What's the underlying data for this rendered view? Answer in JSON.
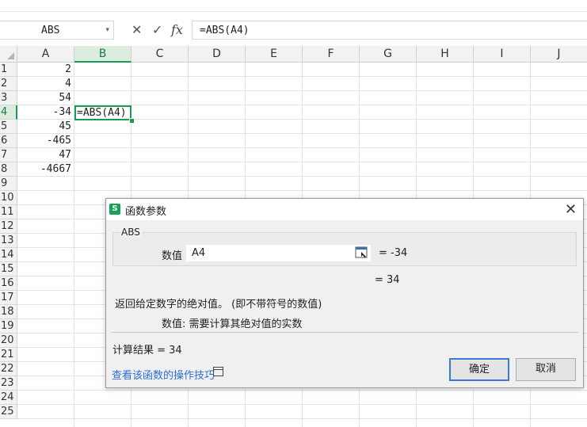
{
  "formula_bar": {
    "name_box": "ABS",
    "cancel_icon": "✕",
    "confirm_icon": "✓",
    "fx_label": "fx",
    "formula": "=ABS(A4)"
  },
  "grid": {
    "columns": [
      "A",
      "B",
      "C",
      "D",
      "E",
      "F",
      "G",
      "H",
      "I",
      "J"
    ],
    "selected_column": "B",
    "rows": [
      "1",
      "2",
      "3",
      "4",
      "5",
      "6",
      "7",
      "8",
      "9",
      "10",
      "11",
      "12",
      "13",
      "14",
      "15",
      "16",
      "17",
      "18",
      "19",
      "20",
      "21",
      "22",
      "23",
      "24",
      "25"
    ],
    "selected_row": "4",
    "column_a_values": [
      "2",
      "4",
      "54",
      "-34",
      "45",
      "-465",
      "47",
      "-4667"
    ],
    "active_cell": "B4",
    "active_cell_content": "=ABS(A4)"
  },
  "dialog": {
    "logo": "S",
    "title": "函数参数",
    "function_name": "ABS",
    "arg_label": "数值",
    "arg_value": "A4",
    "arg_eval": "= -34",
    "formula_result": "= 34",
    "description": "返回给定数字的绝对值。 (即不带符号的数值)",
    "param_description": "数值:  需要计算其绝对值的实数",
    "calc_result": "计算结果 = 34",
    "help_link": "查看该函数的操作技巧",
    "ok_label": "确定",
    "cancel_label": "取消",
    "accent_color": "#1a9d52"
  }
}
